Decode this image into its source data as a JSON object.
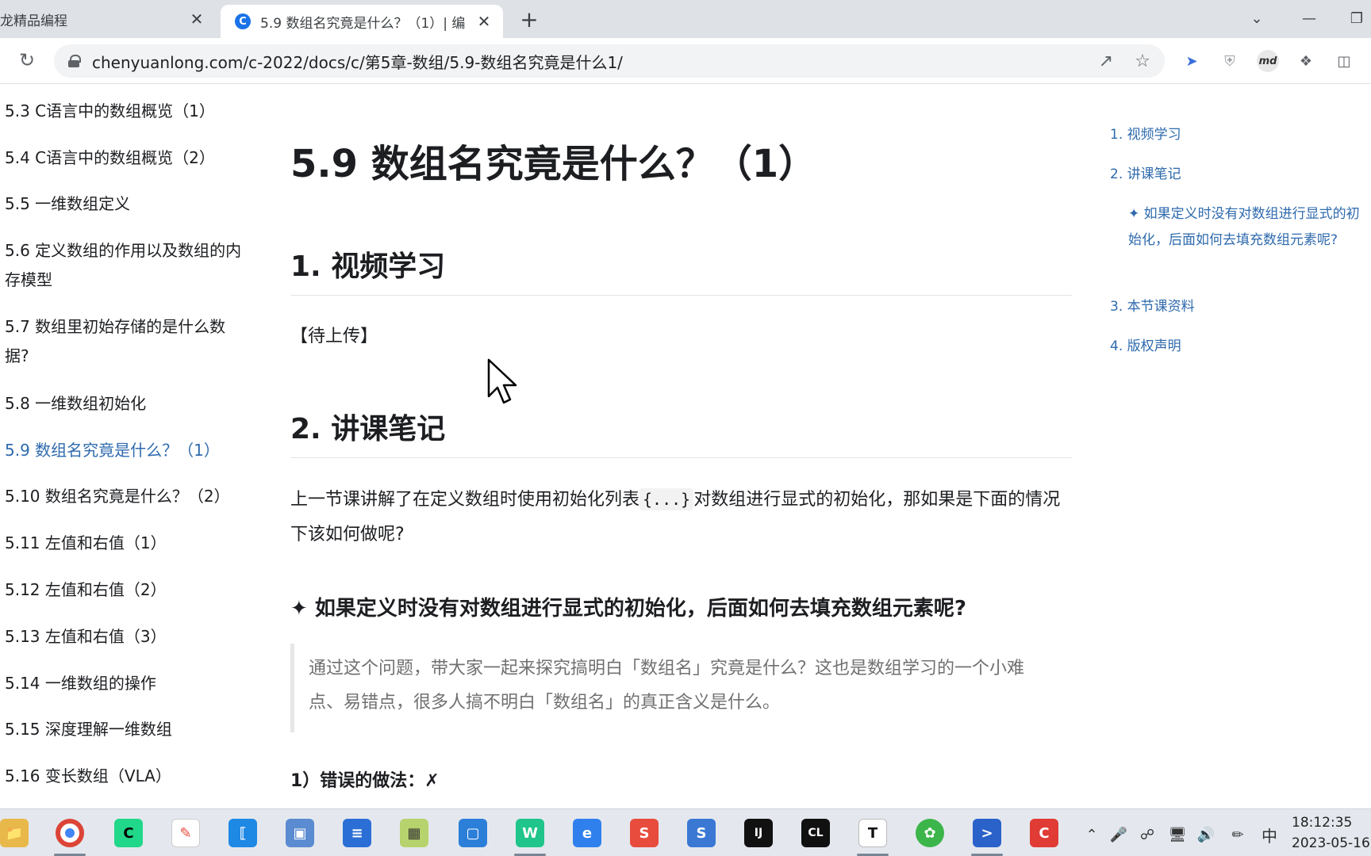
{
  "browser": {
    "tabs": [
      {
        "title": "龙精品编程",
        "active": false
      },
      {
        "title": "5.9 数组名究竟是什么？（1）| 编",
        "active": true
      }
    ],
    "new_tab": "+",
    "close": "✕",
    "url": "chenyuanlong.com/c-2022/docs/c/第5章-数组/5.9-数组名究竟是什么1/",
    "ext_md_label": "md"
  },
  "sidebar": {
    "items": [
      {
        "label": "5.3 C语言中的数组概览（1）"
      },
      {
        "label": "5.4 C语言中的数组概览（2）"
      },
      {
        "label": "5.5 一维数组定义"
      },
      {
        "label": "5.6 定义数组的作用以及数组的内存模型"
      },
      {
        "label": "5.7 数组里初始存储的是什么数据?"
      },
      {
        "label": "5.8 一维数组初始化"
      },
      {
        "label": "5.9 数组名究竟是什么？（1）",
        "active": true
      },
      {
        "label": "5.10 数组名究竟是什么？（2）"
      },
      {
        "label": "5.11 左值和右值（1）"
      },
      {
        "label": "5.12 左值和右值（2）"
      },
      {
        "label": "5.13 左值和右值（3）"
      },
      {
        "label": "5.14 一维数组的操作"
      },
      {
        "label": "5.15 深度理解一维数组"
      },
      {
        "label": "5.16 变长数组（VLA）"
      }
    ]
  },
  "article": {
    "title": "5.9 数组名究竟是什么？（1）",
    "section1": "1. 视频学习",
    "pending": "【待上传】",
    "section2": "2. 讲课笔记",
    "para_before": "上一节课讲解了在定义数组时使用初始化列表",
    "para_code": "{...}",
    "para_after": "对数组进行显式的初始化，那如果是下面的情况下该如何做呢?",
    "subheading": "✦ 如果定义时没有对数组进行显式的初始化，后面如何去填充数组元素呢?",
    "quote": "通过这个问题，带大家一起来探究搞明白「数组名」究竟是什么？这也是数组学习的一个小难点、易错点，很多人搞不明白「数组名」的真正含义是什么。",
    "wrong_method": "1）错误的做法：✗"
  },
  "toc": {
    "items": [
      {
        "label": "1. 视频学习"
      },
      {
        "label": "2. 讲课笔记"
      },
      {
        "label": "✦ 如果定义时没有对数组进行显式的初始化，后面如何去填充数组元素呢?"
      },
      {
        "label": "3. 本节课资料"
      },
      {
        "label": "4. 版权声明"
      }
    ]
  },
  "taskbar": {
    "apps": [
      "file-explorer",
      "chrome",
      "pycharm-edu",
      "notes",
      "vscode",
      "remote-desktop",
      "app-blue",
      "app-green",
      "app-box",
      "webstorm",
      "app-e",
      "wps-presentation",
      "app-s",
      "intellij",
      "clion",
      "typora",
      "app-leaf",
      "powershell",
      "app-c"
    ],
    "ime": "中",
    "time": "18:12:35",
    "date": "2023-05-16"
  },
  "colors": {
    "link": "#2e6aad",
    "tab_bar": "#dee1e6",
    "taskbar": "#e4e8ee"
  }
}
